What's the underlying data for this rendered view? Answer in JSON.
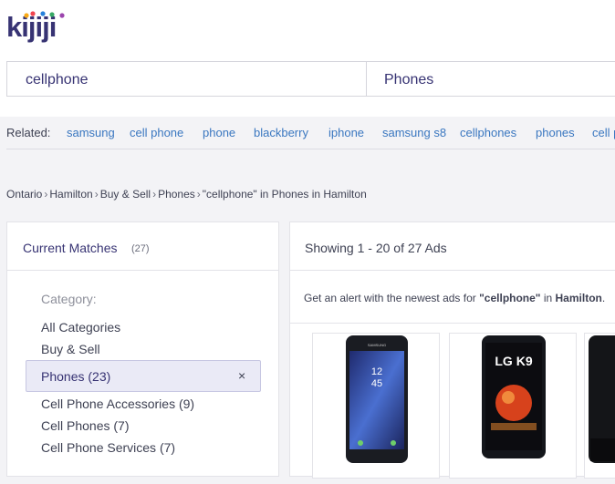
{
  "brand": {
    "logo_text": "kijiji"
  },
  "search": {
    "keyword": "cellphone",
    "category": "Phones"
  },
  "related": {
    "label": "Related:",
    "links": [
      "samsung",
      "cell phone",
      "phone",
      "blackberry",
      "iphone",
      "samsung s8",
      "cellphones",
      "phones",
      "cell p"
    ]
  },
  "breadcrumb": {
    "items": [
      "Ontario",
      "Hamilton",
      "Buy & Sell",
      "Phones"
    ],
    "current": "\"cellphone\" in Phones in Hamilton",
    "separator": "›"
  },
  "filters": {
    "title": "Current Matches",
    "count": "(27)",
    "category_label": "Category:",
    "items": [
      "All Categories",
      "Buy & Sell"
    ],
    "selected": "Phones (23)",
    "remove_glyph": "×",
    "subitems": [
      "Cell Phone Accessories (9)",
      "Cell Phones (7)",
      "Cell Phone Services (7)"
    ]
  },
  "results": {
    "showing": "Showing 1 - 20 of 27 Ads",
    "alert_prefix": "Get an alert with the newest ads for ",
    "alert_keyword": "\"cellphone\"",
    "alert_middle": " in ",
    "alert_location": "Hamilton",
    "alert_suffix": ".",
    "phone1_screen": {
      "brand": "SAMSUNG",
      "time": "12\n45"
    },
    "phone2_screen": {
      "brand": "LG K9"
    }
  },
  "colors": {
    "brand_purple": "#373373",
    "link_blue": "#3a77c0",
    "background": "#f3f3f6"
  }
}
